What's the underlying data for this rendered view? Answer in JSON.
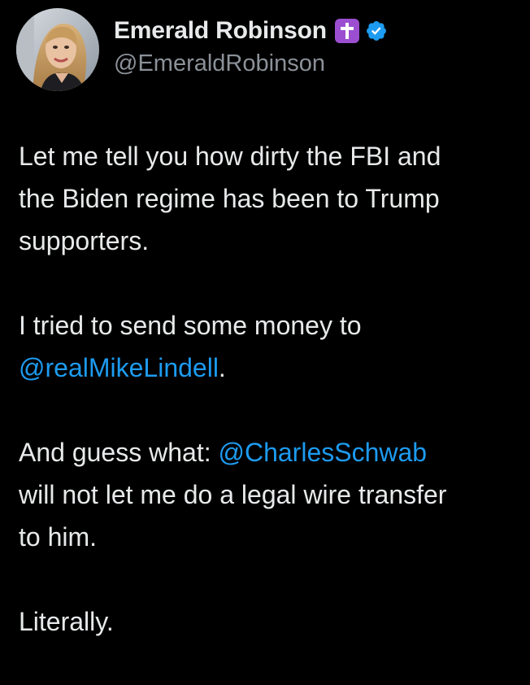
{
  "colors": {
    "background": "#000000",
    "text": "#e7e9ea",
    "secondary_text": "#8b9198",
    "link": "#1d9bf0",
    "verified": "#1d9bf0",
    "cross_badge": "#9b4fd0"
  },
  "author": {
    "display_name": "Emerald Robinson",
    "handle": "@EmeraldRobinson",
    "avatar_icon": "profile-photo",
    "emoji_badge": "latin-cross-emoji",
    "verified_icon": "verified-checkmark-icon"
  },
  "tweet": {
    "p1": {
      "l1": "Let me tell you how dirty the FBI and",
      "l2": "the Biden regime has been to Trump",
      "l3": "supporters."
    },
    "p2": {
      "l1": "I tried to send some money to",
      "mention": "@realMikeLindell",
      "after_mention": "."
    },
    "p3": {
      "before_mention": "And guess what: ",
      "mention": "@CharlesSchwab",
      "l2": "will not let me do a legal wire transfer",
      "l3": "to him."
    },
    "p4": {
      "l1": "Literally."
    }
  }
}
